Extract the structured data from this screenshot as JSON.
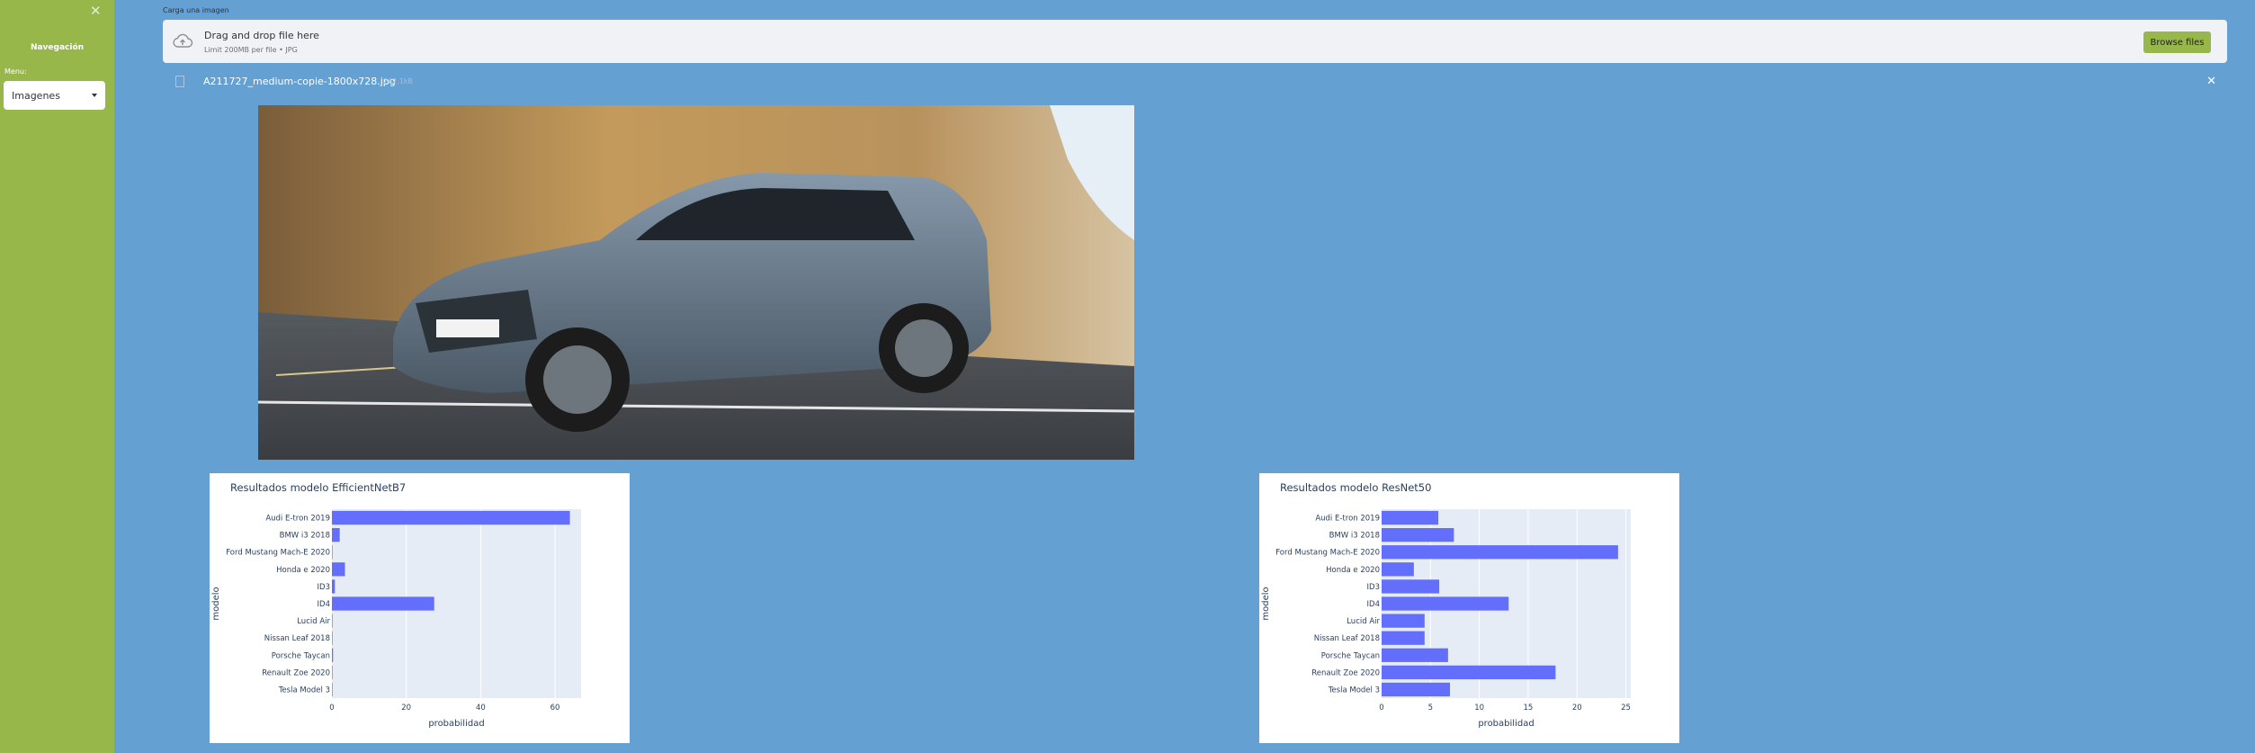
{
  "sidebar": {
    "close_symbol": "✕",
    "title": "Navegación",
    "menu_label": "Menu:",
    "menu_selected": "Imagenes"
  },
  "uploader": {
    "label": "Carga una imagen",
    "drop_title": "Drag and drop file here",
    "drop_subtitle": "Limit 200MB per file • JPG",
    "browse_label": "Browse files",
    "file_name": "A211727_medium-copie-1800x728.jpg",
    "file_size": "262.1kB",
    "remove_symbol": "✕"
  },
  "colors": {
    "sidebar": "#98b74b",
    "background": "#65a0d3",
    "bar": "#636efa",
    "plot_bg": "#e5ecf6"
  },
  "image": {
    "description": "Blue-grey electric SUV driving on a road with rocky cliff background"
  },
  "chart_data": [
    {
      "type": "bar",
      "orientation": "horizontal",
      "title": "Resultados modelo EfficientNetB7",
      "xlabel": "probabilidad",
      "ylabel": "modelo",
      "categories": [
        "Tesla Model 3",
        "Renault Zoe 2020",
        "Porsche Taycan",
        "Nissan Leaf 2018",
        "Lucid Air",
        "ID4",
        "ID3",
        "Honda e 2020",
        "Ford Mustang Mach-E 2020",
        "BMW i3 2018",
        "Audi E-tron 2019"
      ],
      "values": [
        0.1,
        0.1,
        0.3,
        0.1,
        0.1,
        27.5,
        0.8,
        3.5,
        0.1,
        2.1,
        64.0
      ],
      "xlim": [
        0,
        67
      ],
      "xticks": [
        0,
        20,
        40,
        60
      ]
    },
    {
      "type": "bar",
      "orientation": "horizontal",
      "title": "Resultados modelo ResNet50",
      "xlabel": "probabilidad",
      "ylabel": "modelo",
      "categories": [
        "Tesla Model 3",
        "Renault Zoe 2020",
        "Porsche Taycan",
        "Nissan Leaf 2018",
        "Lucid Air",
        "ID4",
        "ID3",
        "Honda e 2020",
        "Ford Mustang Mach-E 2020",
        "BMW i3 2018",
        "Audi E-tron 2019"
      ],
      "values": [
        7.0,
        17.8,
        6.8,
        4.4,
        4.4,
        13.0,
        5.9,
        3.3,
        24.2,
        7.4,
        5.8
      ],
      "xlim": [
        0,
        25.5
      ],
      "xticks": [
        0,
        5,
        10,
        15,
        20,
        25
      ]
    }
  ]
}
